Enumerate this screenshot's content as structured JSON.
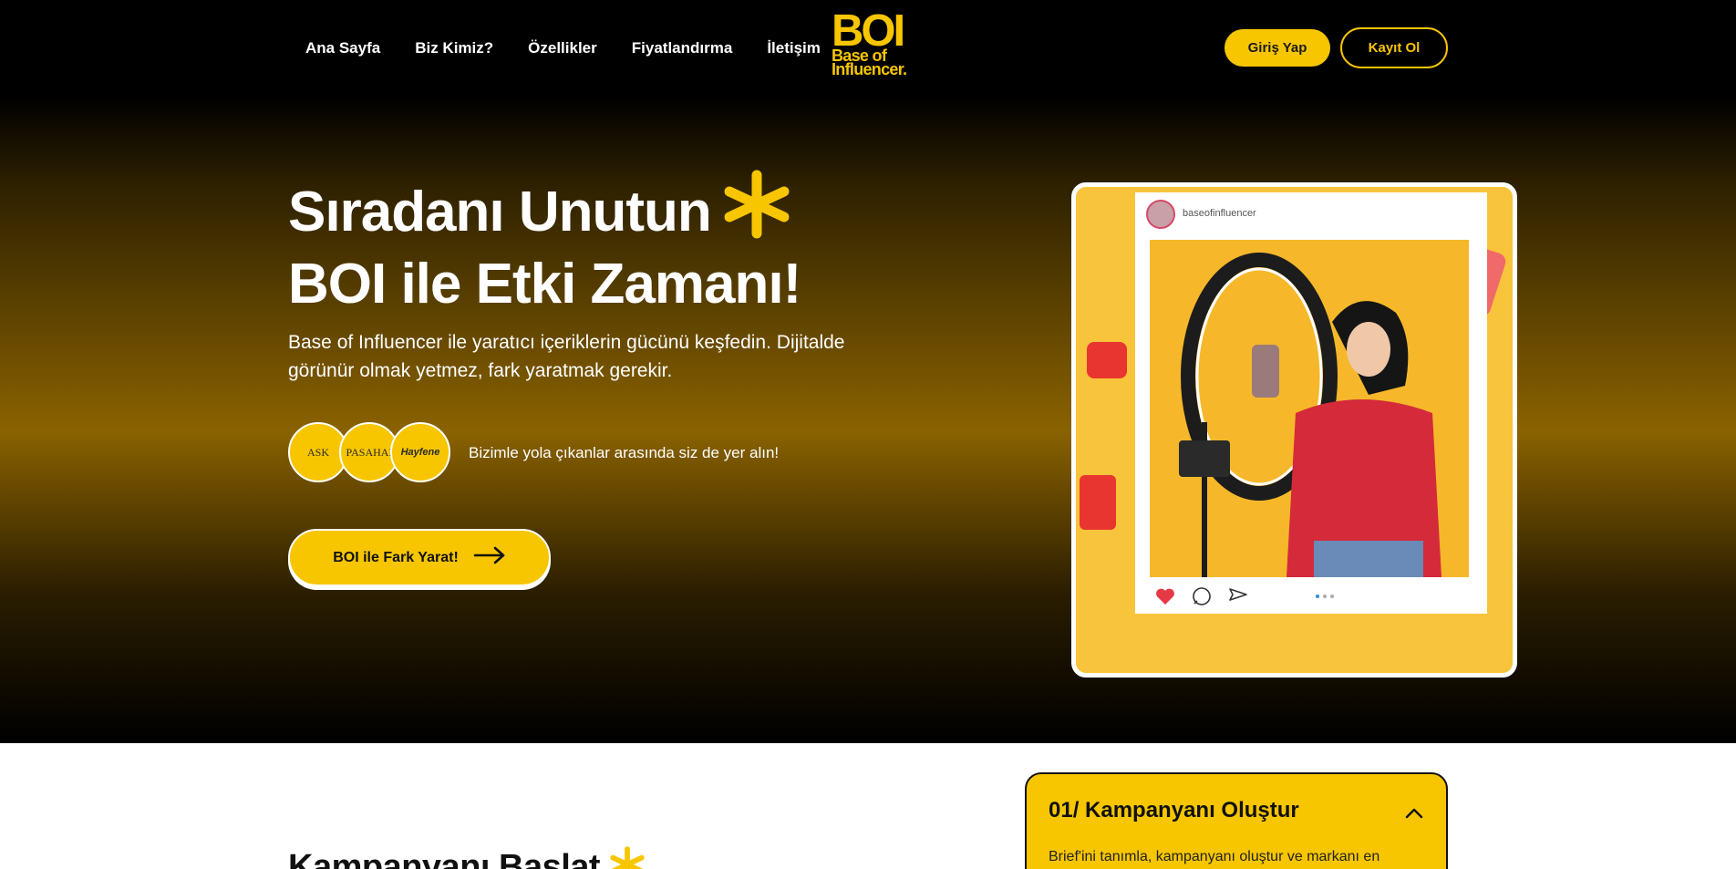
{
  "nav": {
    "links": [
      "Ana Sayfa",
      "Biz Kimiz?",
      "Özellikler",
      "Fiyatlandırma",
      "İletişim"
    ],
    "login": "Giriş Yap",
    "register": "Kayıt Ol"
  },
  "logo": {
    "big": "BOI",
    "line1": "Base of",
    "line2": "Influencer."
  },
  "hero": {
    "headline_line1": "Sıradanı Unutun",
    "headline_line2": "BOI ile Etki Zamanı!",
    "subtitle": "Base of Influencer ile yaratıcı içeriklerin gücünü keşfedin. Dijitalde görünür olmak yetmez, fark yaratmak gerekir.",
    "brands": [
      "ASK",
      "PASAHAI",
      "Hayfene"
    ],
    "brands_text": "Bizimle yola çıkanlar arasında siz de yer alın!",
    "cta": "BOI ile Fark Yarat!",
    "post_user": "baseofinfluencer"
  },
  "section2": {
    "title": "Kampanyanı Başlat",
    "accordion_title": "01/ Kampanyanı Oluştur",
    "accordion_body": "Brief'ini tanımla, kampanyanı oluştur ve markanı en"
  },
  "colors": {
    "accent": "#f7c600",
    "dark": "#000000",
    "white": "#ffffff"
  }
}
